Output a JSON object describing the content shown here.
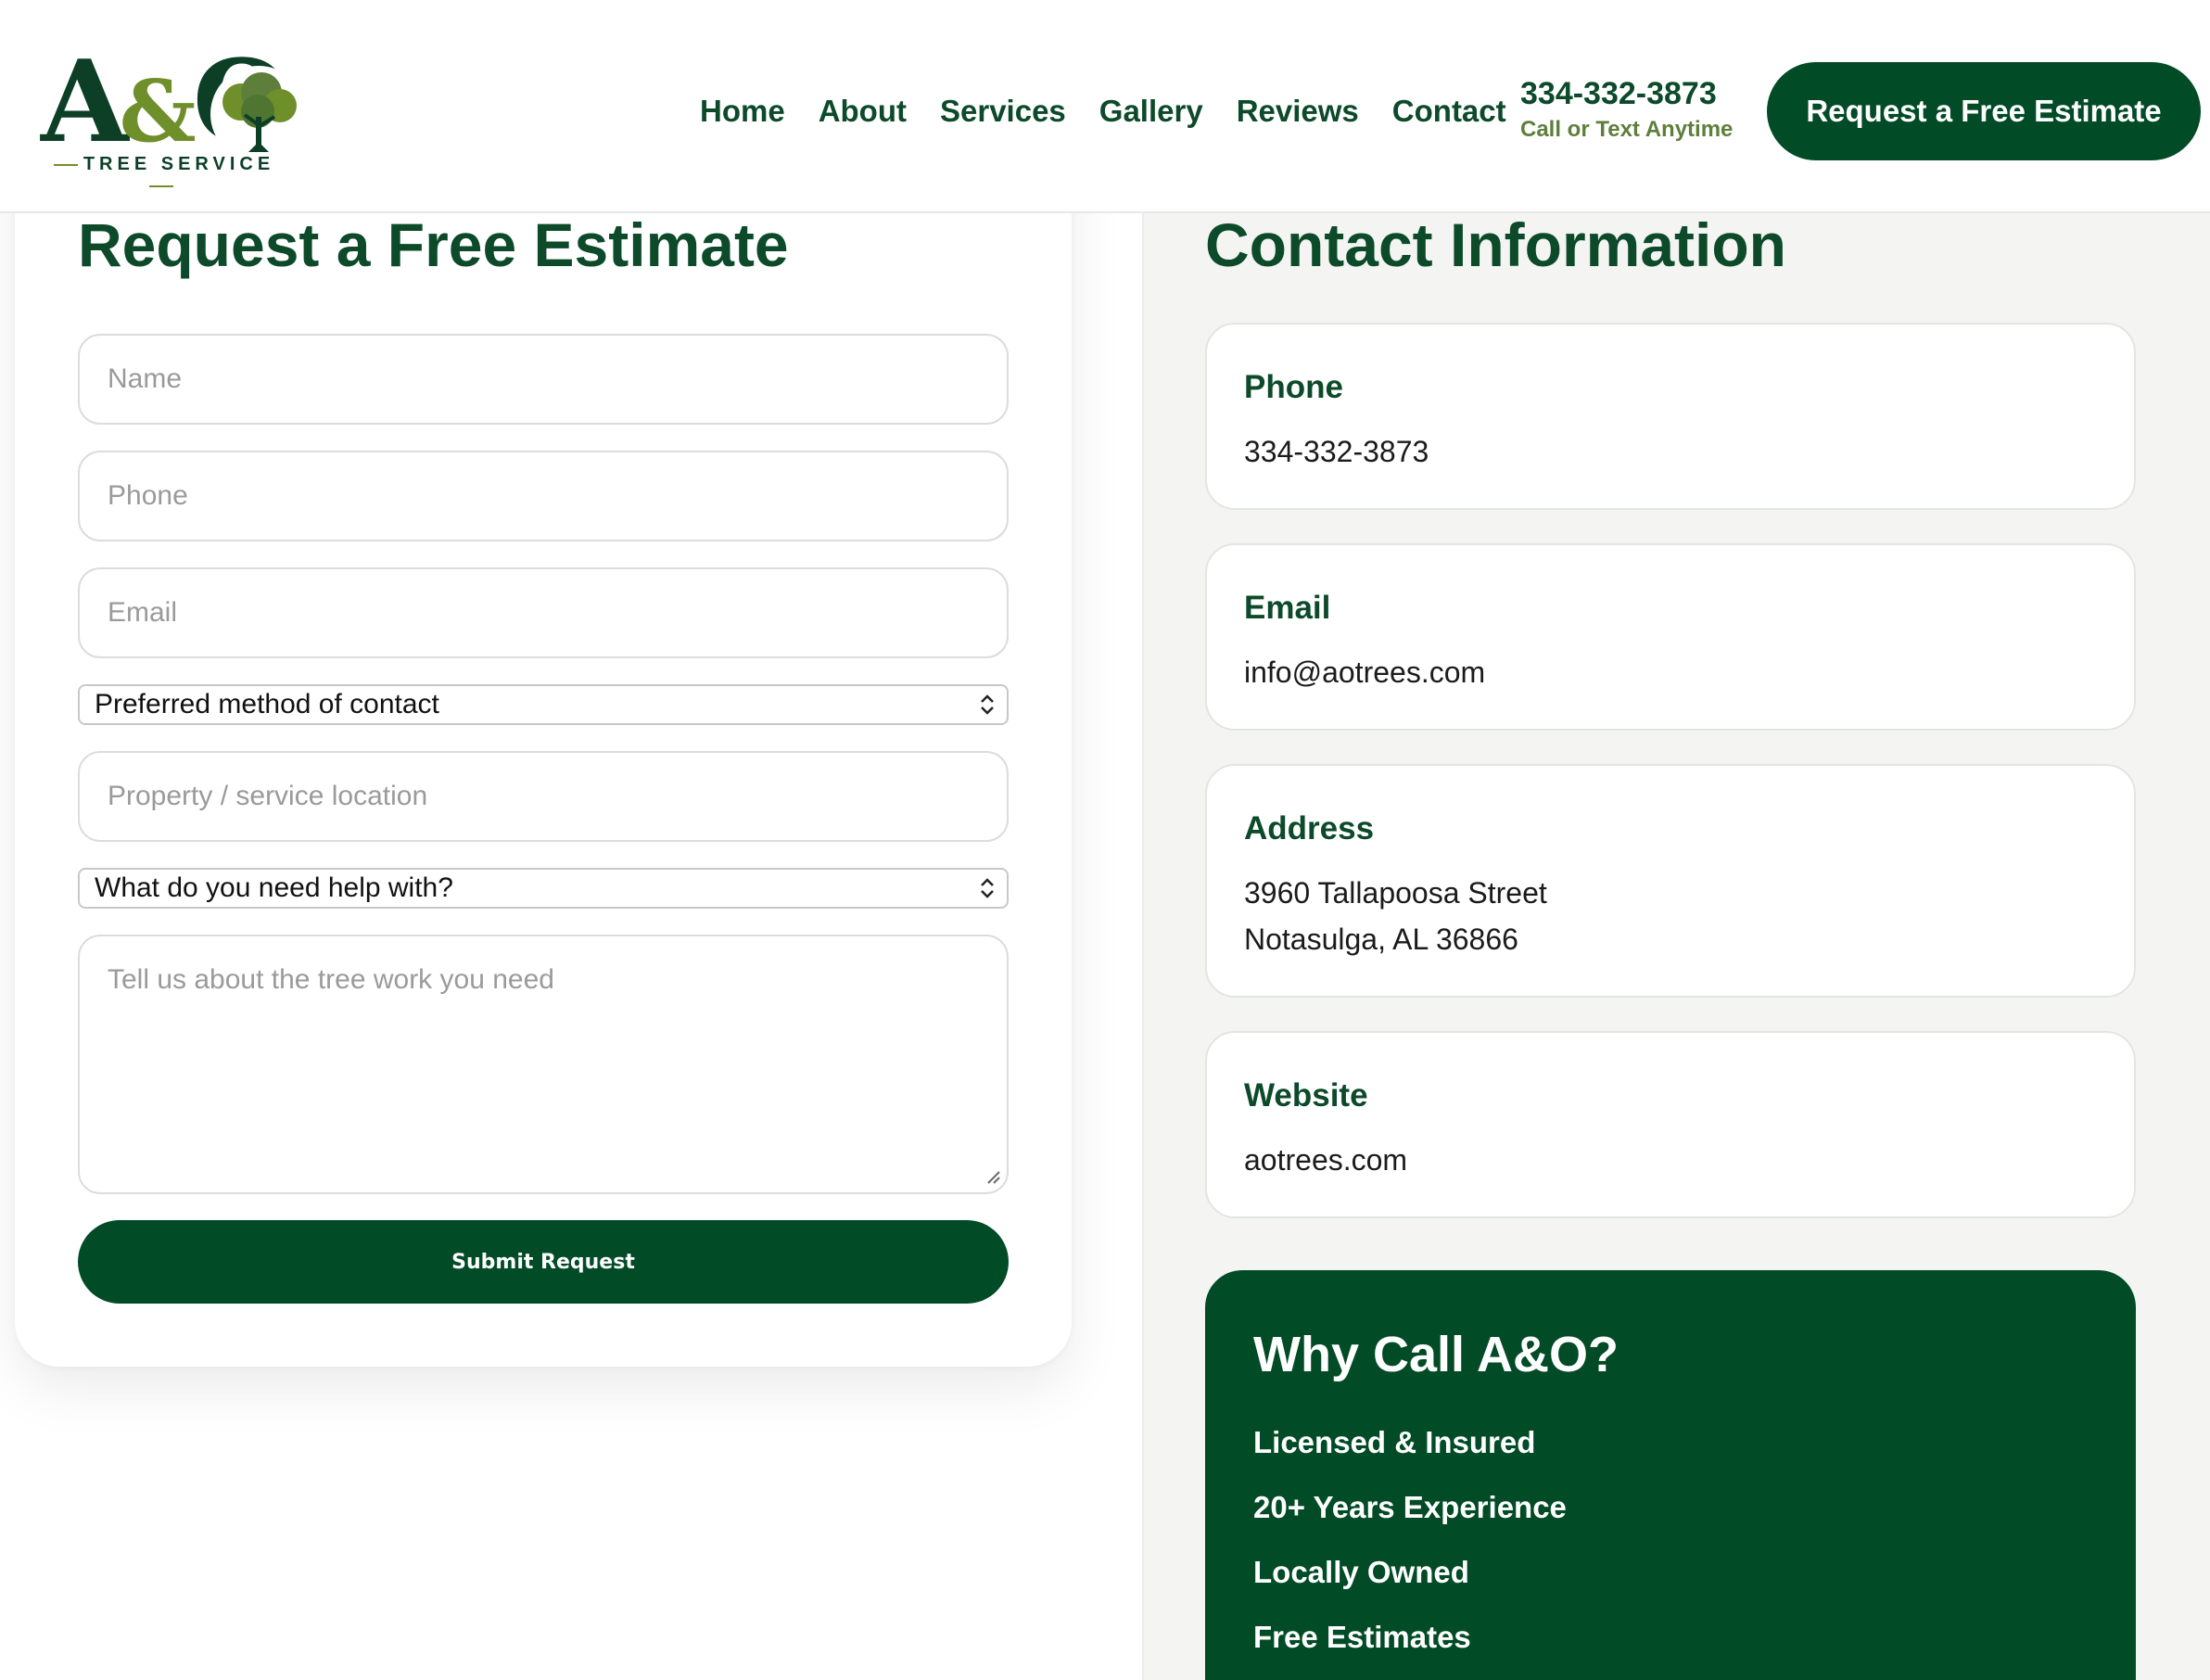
{
  "header": {
    "logo_word_a": "A",
    "logo_word_amp": "&",
    "logo_word_o": "O",
    "logo_sub": "TREE SERVICE",
    "nav": [
      "Home",
      "About",
      "Services",
      "Gallery",
      "Reviews",
      "Contact"
    ],
    "phone": "334-332-3873",
    "phone_sub": "Call or Text Anytime",
    "cta": "Request a Free Estimate"
  },
  "form": {
    "title": "Request a Free Estimate",
    "name_placeholder": "Name",
    "phone_placeholder": "Phone",
    "email_placeholder": "Email",
    "contact_method": "Preferred method of contact",
    "location_placeholder": "Property / service location",
    "help_with": "What do you need help with?",
    "message_placeholder": "Tell us about the tree work you need",
    "submit": "Submit Request"
  },
  "contact": {
    "title": "Contact Information",
    "cards": [
      {
        "label": "Phone",
        "lines": [
          "334-332-3873"
        ]
      },
      {
        "label": "Email",
        "lines": [
          "info@aotrees.com"
        ]
      },
      {
        "label": "Address",
        "lines": [
          "3960 Tallapoosa Street",
          "Notasulga, AL 36866"
        ]
      },
      {
        "label": "Website",
        "lines": [
          "aotrees.com"
        ]
      }
    ]
  },
  "why": {
    "title": "Why Call A&O?",
    "items": [
      "Licensed & Insured",
      "20+ Years Experience",
      "Locally Owned",
      "Free Estimates"
    ]
  },
  "colors": {
    "brand_green": "#024b27",
    "accent_olive": "#6f8f2a",
    "text_green": "#0c4a2a"
  }
}
